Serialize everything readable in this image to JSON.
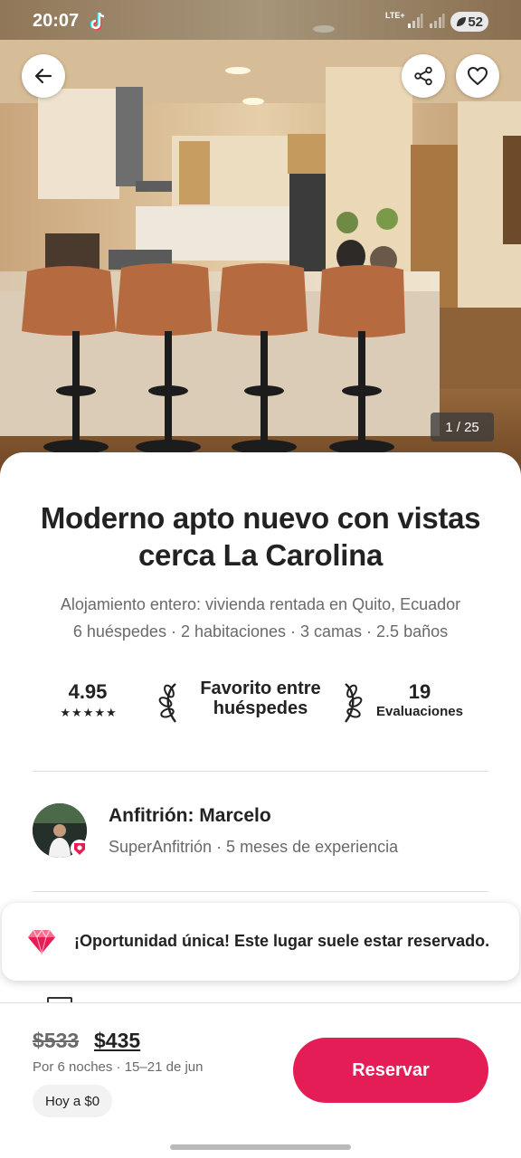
{
  "status_bar": {
    "time": "20:07",
    "network": "LTE+",
    "battery_level": "52",
    "icons": [
      "tiktok-icon",
      "signal-icon",
      "battery-icon"
    ]
  },
  "gallery": {
    "counter": "1 / 25",
    "back_icon": "arrow-left-icon",
    "share_icon": "share-icon",
    "favorite_icon": "heart-outline-icon"
  },
  "listing": {
    "title": "Moderno apto nuevo con vistas cerca La Carolina",
    "subtitle": "Alojamiento entero: vivienda rentada en Quito, Ecuador",
    "details": "6 huéspedes · 2 habitaciones · 3 camas · 2.5 baños"
  },
  "stats": {
    "rating": "4.95",
    "stars": "★★★★★",
    "guest_favorite": "Favorito entre huéspedes",
    "reviews_count": "19",
    "reviews_label": "Evaluaciones"
  },
  "host": {
    "name": "Anfitrión: Marcelo",
    "info": "SuperAnfitrión · 5 meses de experiencia"
  },
  "rare_find": {
    "text": "¡Oportunidad única! Este lugar suele estar reservado.",
    "icon": "diamond-icon"
  },
  "footer": {
    "old_price": "$533",
    "new_price": "$435",
    "nights": "Por 6 noches · 15–21 de jun",
    "pay_today": "Hoy a $0",
    "reserve_label": "Reservar"
  },
  "colors": {
    "accent": "#e51d56",
    "text_primary": "#222222",
    "text_secondary": "#6a6a6a"
  }
}
